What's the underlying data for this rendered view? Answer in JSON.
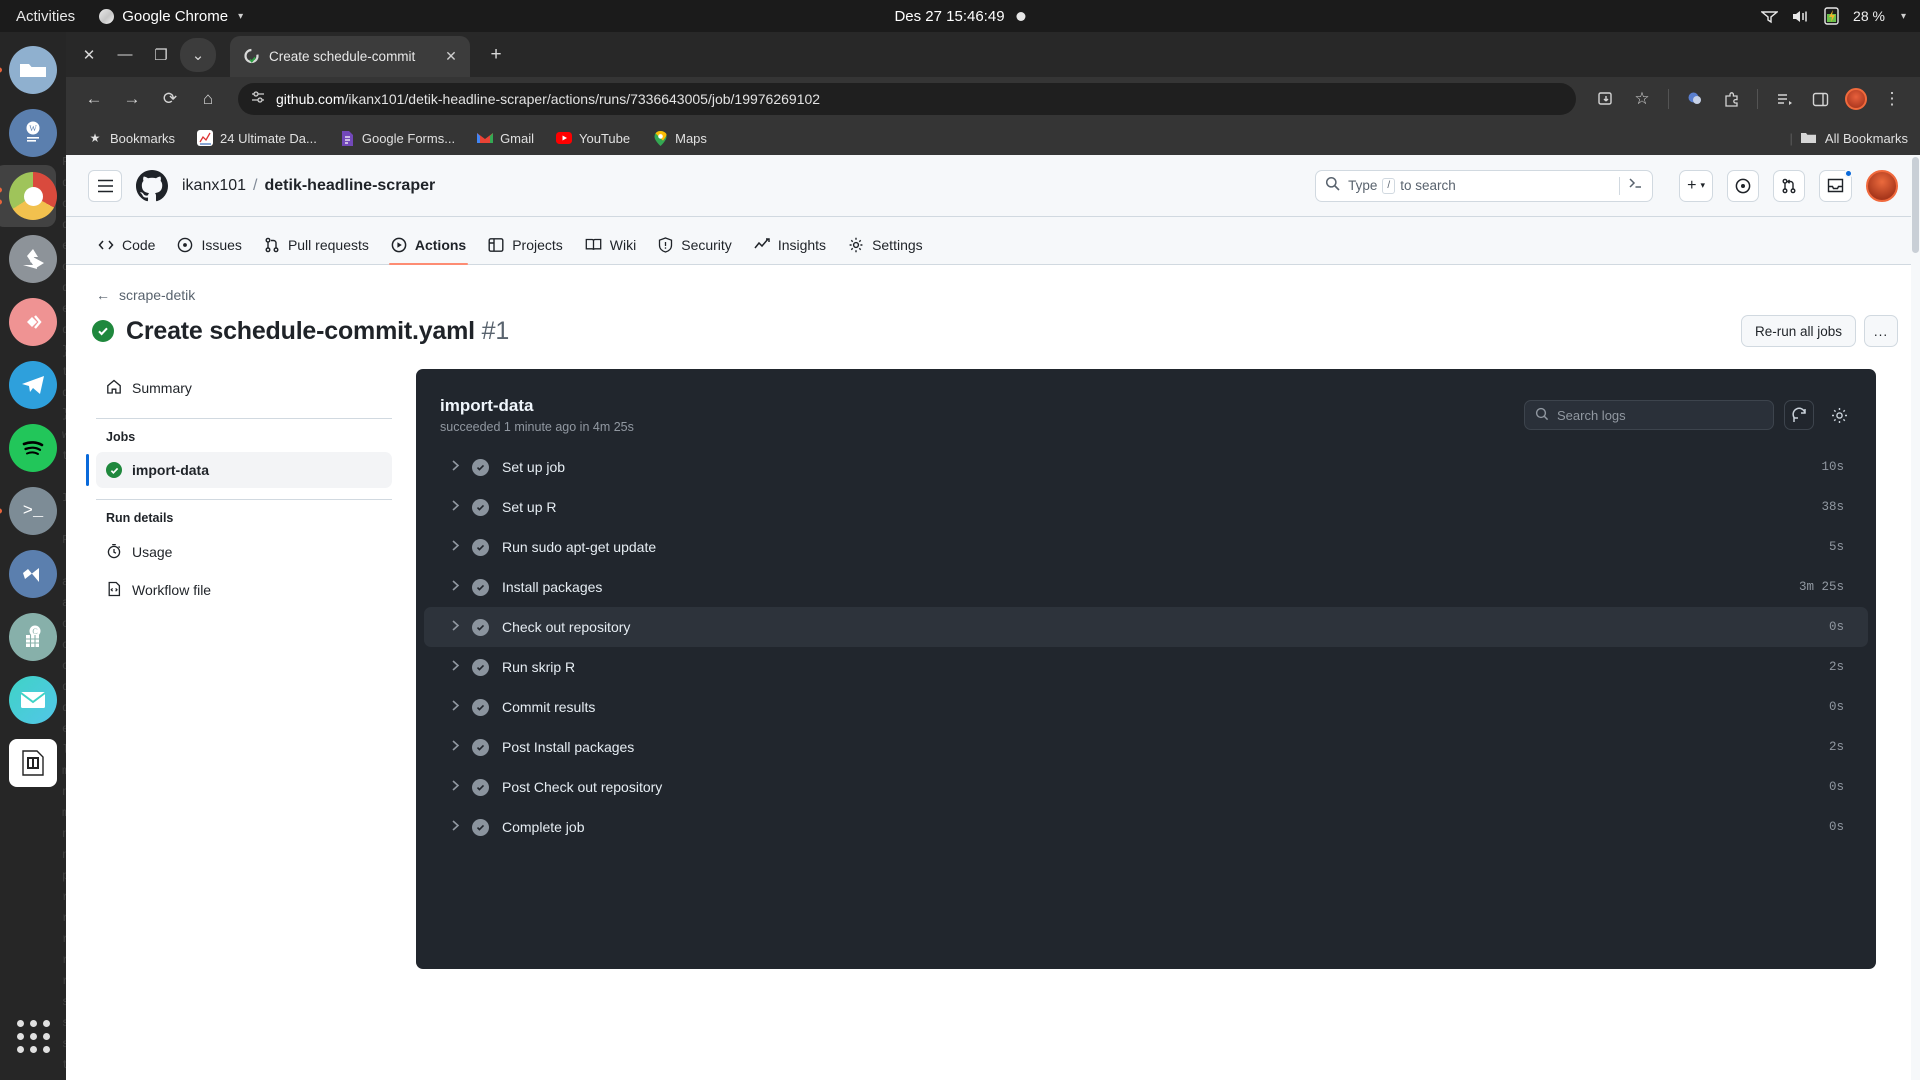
{
  "gnome": {
    "activities": "Activities",
    "app_name": "Google Chrome",
    "caret": "▾",
    "clock": "Des 27  15:46:49",
    "battery": "28 %",
    "battery_caret": "▾"
  },
  "dock": {
    "items": [
      {
        "name": "files",
        "label": "Files"
      },
      {
        "name": "writer",
        "label": "LibreOffice Writer"
      },
      {
        "name": "chrome",
        "label": "Google Chrome"
      },
      {
        "name": "backup",
        "label": "Backups"
      },
      {
        "name": "diamond",
        "label": "App"
      },
      {
        "name": "telegram",
        "label": "Telegram"
      },
      {
        "name": "spotify",
        "label": "Spotify"
      },
      {
        "name": "terminal",
        "label": "Terminal"
      },
      {
        "name": "vscode",
        "label": "Visual Studio Code"
      },
      {
        "name": "calc",
        "label": "LibreOffice Calc"
      },
      {
        "name": "mail",
        "label": "Mail"
      },
      {
        "name": "filemanager",
        "label": "File Manager"
      }
    ]
  },
  "browser": {
    "tab": {
      "title": "Create schedule-commit",
      "close": "✕",
      "new_tab": "+"
    },
    "window_controls": {
      "close": "✕",
      "minimize": "—",
      "restore": "❐",
      "chevron": "⌄"
    },
    "toolbar": {
      "back": "←",
      "forward": "→",
      "reload": "⟳",
      "home": "⌂",
      "url_host": "github.com",
      "url_path": "/ikanx101/detik-headline-scraper/actions/runs/7336643005/job/19976269102",
      "install_icon": "install-icon",
      "bookmark_star": "☆",
      "extensions_icon": "extensions-icon",
      "profile_icon": "profile-icon",
      "menu_icon": "⋮"
    },
    "bookmarks": {
      "root_label": "Bookmarks",
      "items": [
        {
          "label": "24 Ultimate Da...",
          "icon": "chart-icon"
        },
        {
          "label": "Google Forms...",
          "icon": "forms-icon"
        },
        {
          "label": "Gmail",
          "icon": "gmail-icon"
        },
        {
          "label": "YouTube",
          "icon": "youtube-icon"
        },
        {
          "label": "Maps",
          "icon": "maps-icon"
        }
      ],
      "all_bookmarks": "All Bookmarks"
    }
  },
  "github": {
    "header": {
      "owner": "ikanx101",
      "separator": "/",
      "repo": "detik-headline-scraper",
      "search_placeholder": "Type",
      "search_slash": "/",
      "search_placeholder_tail": "to search",
      "plus": "+",
      "plus_caret": "▾"
    },
    "nav": [
      {
        "label": "Code",
        "icon": "code-icon",
        "active": false
      },
      {
        "label": "Issues",
        "icon": "issue-icon",
        "active": false
      },
      {
        "label": "Pull requests",
        "icon": "pull-request-icon",
        "active": false
      },
      {
        "label": "Actions",
        "icon": "play-icon",
        "active": true
      },
      {
        "label": "Projects",
        "icon": "project-icon",
        "active": false
      },
      {
        "label": "Wiki",
        "icon": "book-icon",
        "active": false
      },
      {
        "label": "Security",
        "icon": "shield-icon",
        "active": false
      },
      {
        "label": "Insights",
        "icon": "graph-icon",
        "active": false
      },
      {
        "label": "Settings",
        "icon": "gear-icon",
        "active": false
      }
    ],
    "run": {
      "back_arrow": "←",
      "back_label": "scrape-detik",
      "title": "Create schedule-commit.yaml",
      "number": "#1",
      "status": "success",
      "rerun_label": "Re-run all jobs",
      "more_label": "..."
    },
    "sidebar": {
      "summary": "Summary",
      "jobs_heading": "Jobs",
      "job": {
        "label": "import-data",
        "status": "success"
      },
      "run_details_heading": "Run details",
      "usage": "Usage",
      "workflow_file": "Workflow file"
    },
    "logs": {
      "job_title": "import-data",
      "job_subtitle": "succeeded 1 minute ago in 4m 25s",
      "search_placeholder": "Search logs",
      "refresh_icon": "refresh-icon",
      "settings_icon": "gear-icon",
      "steps": [
        {
          "label": "Set up job",
          "duration": "10s",
          "status": "success",
          "hover": false
        },
        {
          "label": "Set up R",
          "duration": "38s",
          "status": "success",
          "hover": false
        },
        {
          "label": "Run sudo apt-get update",
          "duration": "5s",
          "status": "success",
          "hover": false
        },
        {
          "label": "Install packages",
          "duration": "3m 25s",
          "status": "success",
          "hover": false
        },
        {
          "label": "Check out repository",
          "duration": "0s",
          "status": "success",
          "hover": true
        },
        {
          "label": "Run skrip R",
          "duration": "2s",
          "status": "success",
          "hover": false
        },
        {
          "label": "Commit results",
          "duration": "0s",
          "status": "success",
          "hover": false
        },
        {
          "label": "Post Install packages",
          "duration": "2s",
          "status": "success",
          "hover": false
        },
        {
          "label": "Post Check out repository",
          "duration": "0s",
          "status": "success",
          "hover": false
        },
        {
          "label": "Complete job",
          "duration": "0s",
          "status": "success",
          "hover": false
        }
      ]
    }
  },
  "colors": {
    "success_green": "#1f883d",
    "actions_accent": "#fd8c73",
    "link_blue": "#0969da",
    "log_bg": "#21262d",
    "gh_bg": "#ffffff"
  }
}
